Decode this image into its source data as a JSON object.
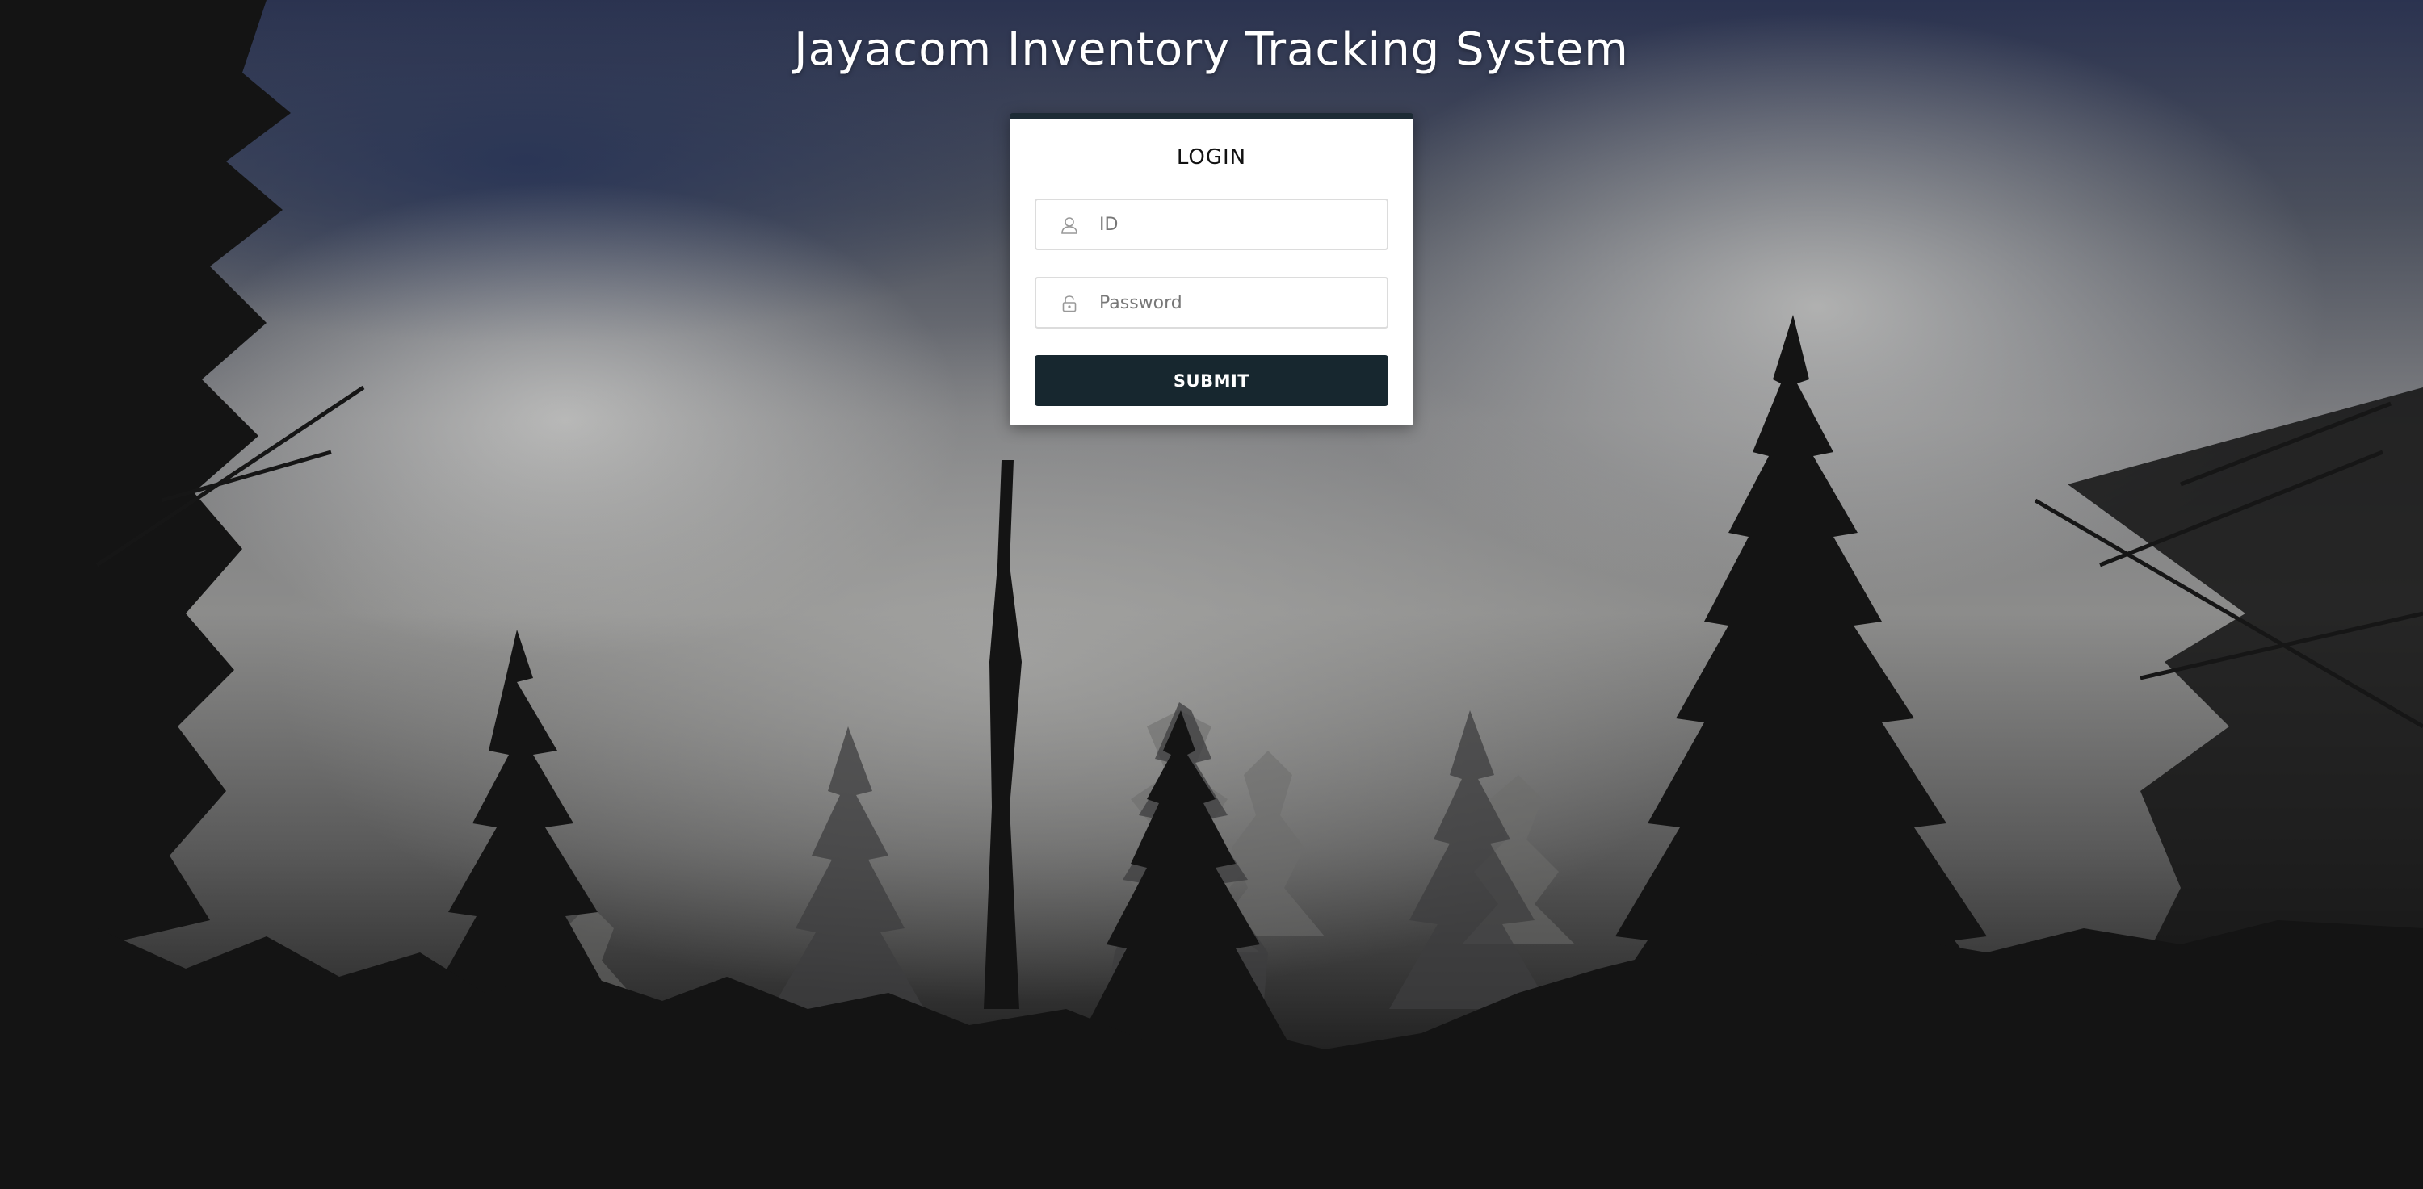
{
  "page": {
    "title": "Jayacom Inventory Tracking System"
  },
  "login": {
    "heading": "LOGIN",
    "id_field": {
      "placeholder": "ID",
      "value": "",
      "icon": "user-icon"
    },
    "password_field": {
      "placeholder": "Password",
      "value": "",
      "icon": "lock-icon"
    },
    "submit_label": "SUBMIT"
  },
  "colors": {
    "card_accent": "#1d2b35",
    "button_bg": "#17272f",
    "title_text": "#ffffff"
  }
}
